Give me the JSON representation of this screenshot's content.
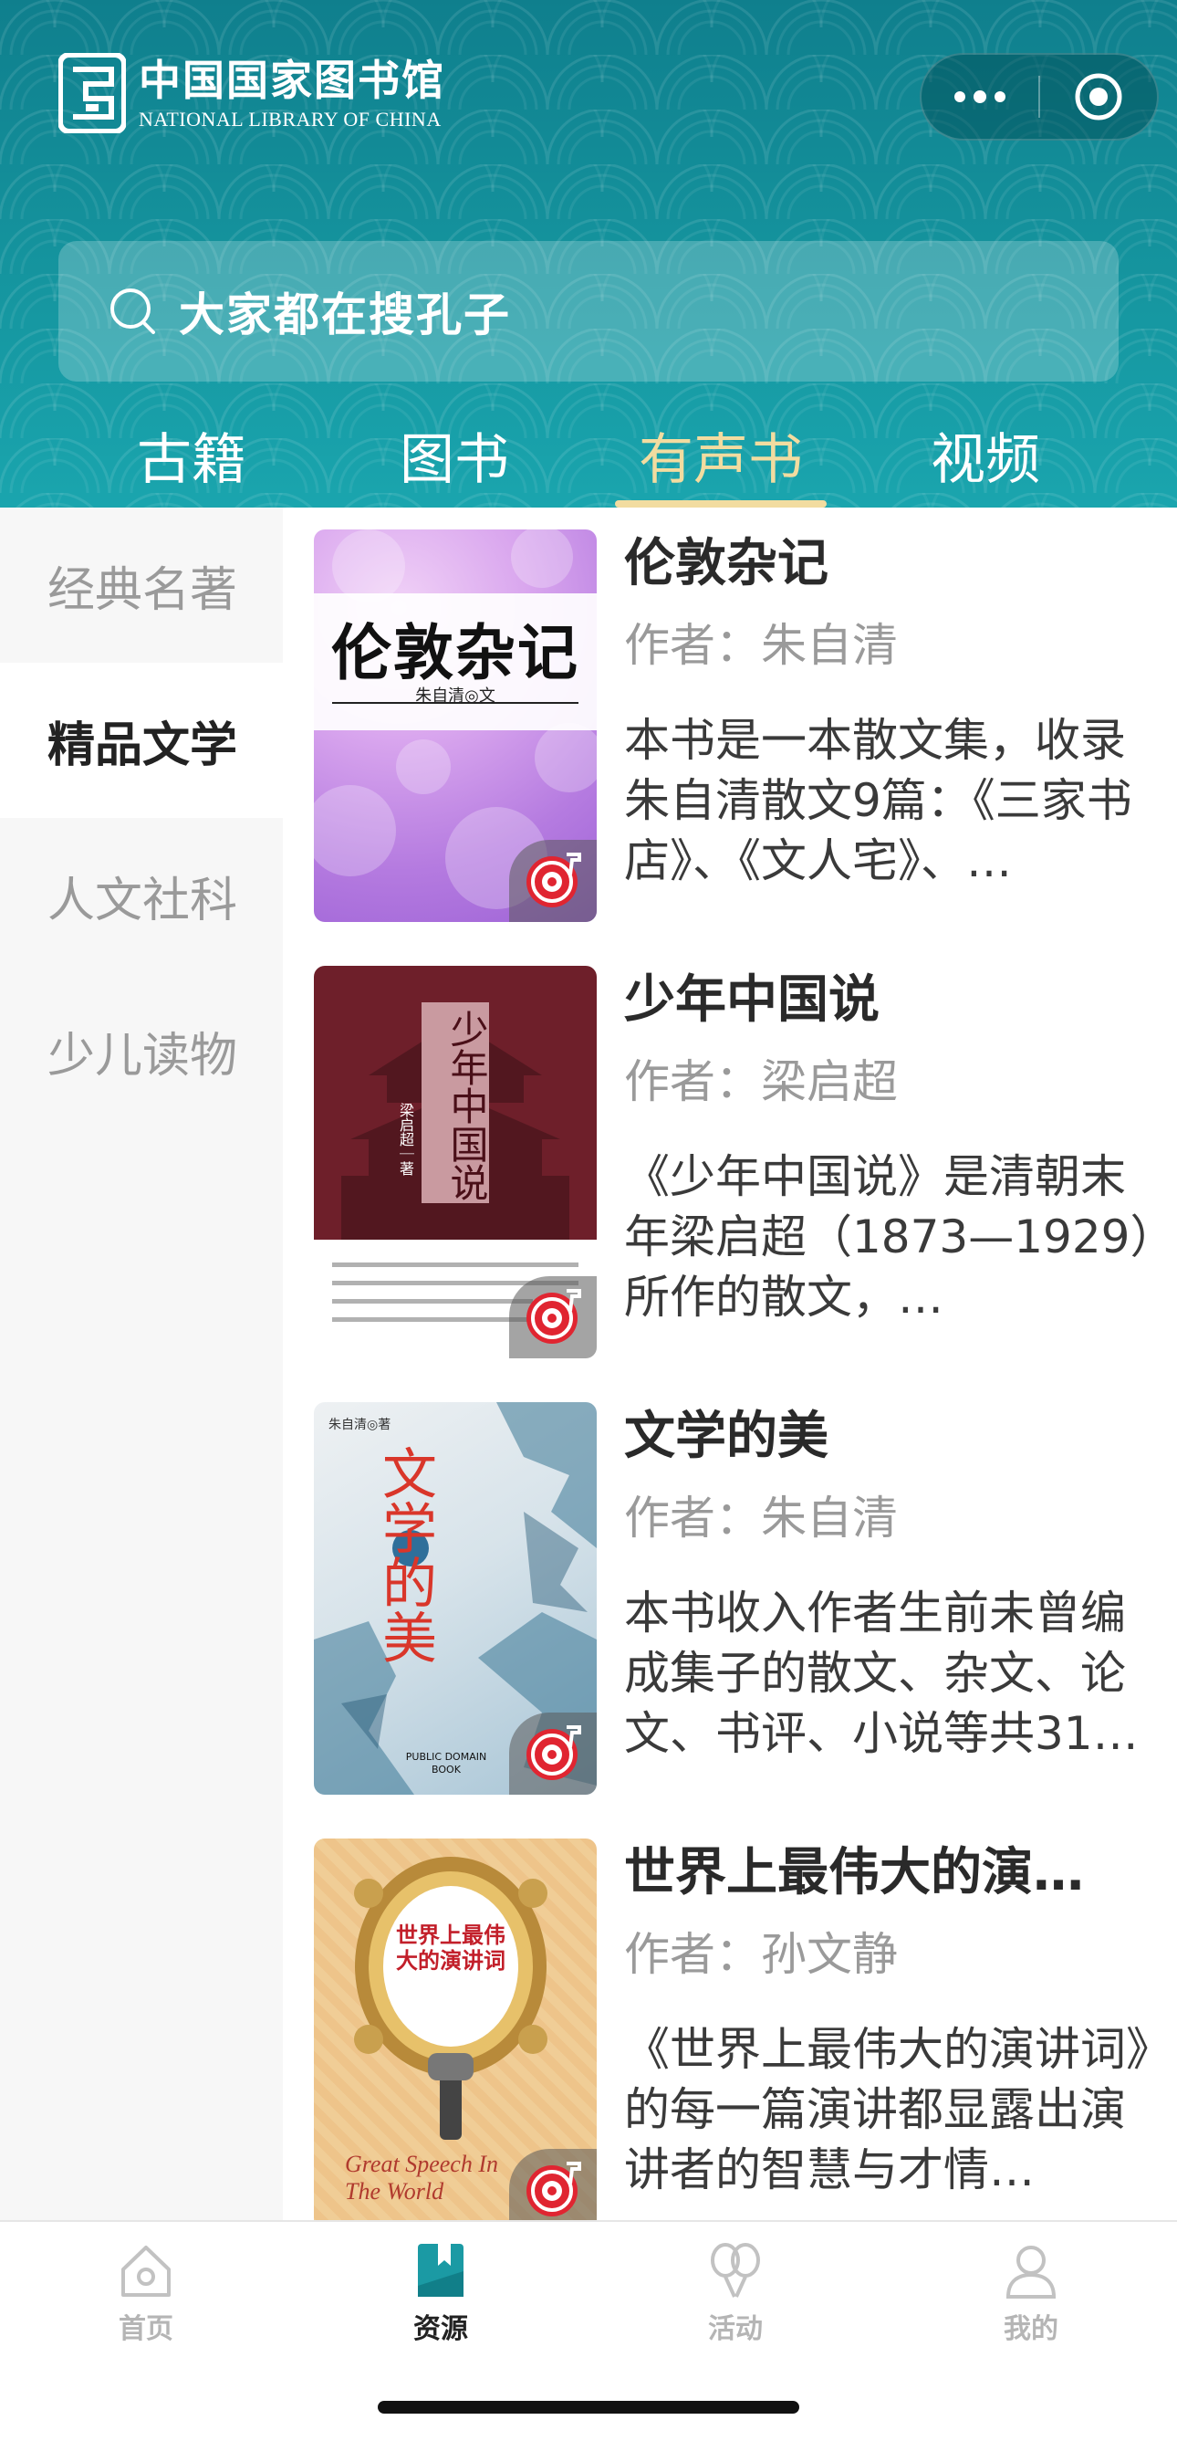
{
  "brand": {
    "name_cn": "中国国家图书馆",
    "name_en": "NATIONAL LIBRARY OF CHINA",
    "primary_color": "#13919c",
    "accent_color": "#f2dca0"
  },
  "capsule": {
    "more_icon": "more-dots-icon",
    "close_icon": "target-circle-icon"
  },
  "search": {
    "icon": "search-icon",
    "placeholder": "大家都在搜孔子"
  },
  "tabs": [
    {
      "label": "古籍",
      "active": false
    },
    {
      "label": "图书",
      "active": false
    },
    {
      "label": "有声书",
      "active": true
    },
    {
      "label": "视频",
      "active": false
    }
  ],
  "sidebar": {
    "items": [
      {
        "label": "经典名著",
        "active": false
      },
      {
        "label": "精品文学",
        "active": true
      },
      {
        "label": "人文社科",
        "active": false
      },
      {
        "label": "少儿读物",
        "active": false
      }
    ]
  },
  "books": [
    {
      "title": "伦敦杂记",
      "author": "作者：朱自清",
      "description": "本书是一本散文集，收录朱自清散文9篇：《三家书店》、《文人宅》、…",
      "cover": {
        "title": "伦敦杂记",
        "subtitle": "朱自清◎文"
      }
    },
    {
      "title": "少年中国说",
      "author": "作者：梁启超",
      "description": "《少年中国说》是清朝末年梁启超（1873—1929）所作的散文，…",
      "cover": {
        "title": "少年中国说",
        "subtitle": "梁启超｜著"
      }
    },
    {
      "title": "文学的美",
      "author": "作者：朱自清",
      "description": "本书收入作者生前未曾编成集子的散文、杂文、论文、书评、小说等共31…",
      "cover": {
        "title": "文学的美",
        "top_text": "朱自清◎著",
        "bottom_text": "PUBLIC DOMAIN BOOK"
      }
    },
    {
      "title": "世界上最伟大的演…",
      "author": "作者：孙文静",
      "description": "《世界上最伟大的演讲词》的每一篇演讲都显露出演讲者的智慧与才情…",
      "cover": {
        "title": "世界上最伟大的演讲词",
        "script_text": "Great Speech In The World"
      }
    }
  ],
  "bottom_nav": [
    {
      "label": "首页",
      "icon": "home-icon",
      "active": false
    },
    {
      "label": "资源",
      "icon": "bookmark-book-icon",
      "active": true
    },
    {
      "label": "活动",
      "icon": "balloons-icon",
      "active": false
    },
    {
      "label": "我的",
      "icon": "user-icon",
      "active": false
    }
  ]
}
